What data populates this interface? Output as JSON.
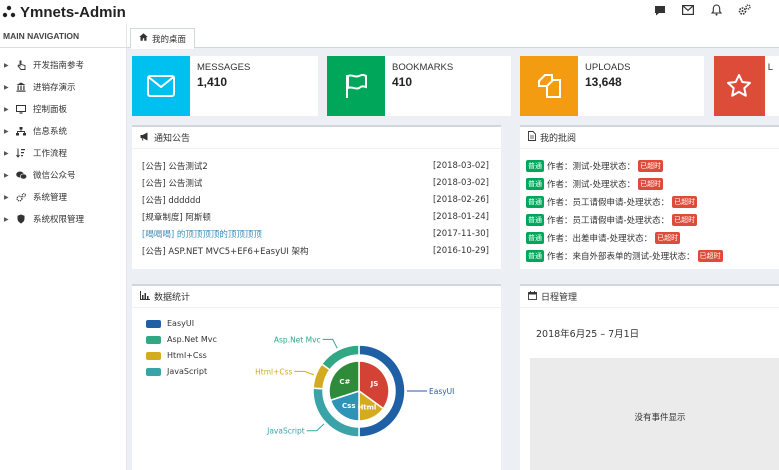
{
  "app": {
    "title": "Ymnets-Admin"
  },
  "header_icons": [
    "chat-icon",
    "mail-icon",
    "bell-icon",
    "cogs-icon"
  ],
  "sidebar": {
    "header": "MAIN NAVIGATION",
    "items": [
      {
        "label": "开发指南参考",
        "icon": "hand-pointer-icon"
      },
      {
        "label": "进销存演示",
        "icon": "bank-icon"
      },
      {
        "label": "控制面板",
        "icon": "monitor-icon"
      },
      {
        "label": "信息系统",
        "icon": "sitemap-icon"
      },
      {
        "label": "工作流程",
        "icon": "sort-icon"
      },
      {
        "label": "微信公众号",
        "icon": "wechat-icon"
      },
      {
        "label": "系统管理",
        "icon": "cogs-icon"
      },
      {
        "label": "系统权限管理",
        "icon": "shield-icon"
      }
    ]
  },
  "tabs": [
    {
      "label": "我的桌面",
      "icon": "home-icon"
    }
  ],
  "stats": [
    {
      "label": "MESSAGES",
      "value": "1,410",
      "color": "#00c0ef",
      "icon": "envelope-icon"
    },
    {
      "label": "BOOKMARKS",
      "value": "410",
      "color": "#00a65a",
      "icon": "flag-icon"
    },
    {
      "label": "UPLOADS",
      "value": "13,648",
      "color": "#f39c12",
      "icon": "files-icon"
    },
    {
      "label": "L",
      "value": "",
      "color": "#dd4b39",
      "icon": "star-icon"
    }
  ],
  "notice_panel": {
    "title": "通知公告",
    "items": [
      {
        "title": "[公告] 公告测试2",
        "date": "[2018-03-02]",
        "highlight": false
      },
      {
        "title": "[公告] 公告测试",
        "date": "[2018-03-02]",
        "highlight": false
      },
      {
        "title": "[公告] dddddd",
        "date": "[2018-02-26]",
        "highlight": false
      },
      {
        "title": "[规章制度] 阿斯顿",
        "date": "[2018-01-24]",
        "highlight": false
      },
      {
        "title": "[喝喝喝] 的顶顶顶顶的顶顶顶顶",
        "date": "[2017-11-30]",
        "highlight": true
      },
      {
        "title": "[公告] ASP.NET MVC5+EF6+EasyUI 架构",
        "date": "[2016-10-29]",
        "highlight": false
      }
    ]
  },
  "approval_panel": {
    "title": "我的批阅",
    "badge_normal": "普通",
    "badge_overdue": "已超时",
    "items": [
      {
        "text": "作者：测试-处理状态："
      },
      {
        "text": "作者：测试-处理状态："
      },
      {
        "text": "作者：员工请假申请-处理状态："
      },
      {
        "text": "作者：员工请假申请-处理状态："
      },
      {
        "text": "作者：出差申请-处理状态："
      },
      {
        "text": "作者：来自外部表单的测试-处理状态："
      }
    ]
  },
  "stats_panel": {
    "title": "数据统计"
  },
  "chart_data": {
    "type": "pie",
    "legend": [
      "EasyUI",
      "Asp.Net Mvc",
      "Html+Css",
      "JavaScript"
    ],
    "outer_ring": [
      {
        "name": "EasyUI",
        "value": 50,
        "color": "#1f5fa6"
      },
      {
        "name": "JavaScript",
        "value": 26,
        "color": "#3aa3a8"
      },
      {
        "name": "Html+Css",
        "value": 9,
        "color": "#d4aa1f"
      },
      {
        "name": "Asp.Net Mvc",
        "value": 15,
        "color": "#32a784"
      }
    ],
    "inner_pie": [
      {
        "name": "JS",
        "value": 35,
        "color": "#d44135"
      },
      {
        "name": "Html",
        "value": 15,
        "color": "#d4aa1f"
      },
      {
        "name": "Css",
        "value": 20,
        "color": "#2f93b8"
      },
      {
        "name": "C#",
        "value": 30,
        "color": "#2e8b3a"
      }
    ],
    "legend_colors": [
      "#1f5fa6",
      "#32a784",
      "#d4aa1f",
      "#3aa3a8"
    ]
  },
  "calendar_panel": {
    "title": "日程管理",
    "range": "2018年6月25 – 7月1日",
    "empty_text": "没有事件显示"
  }
}
